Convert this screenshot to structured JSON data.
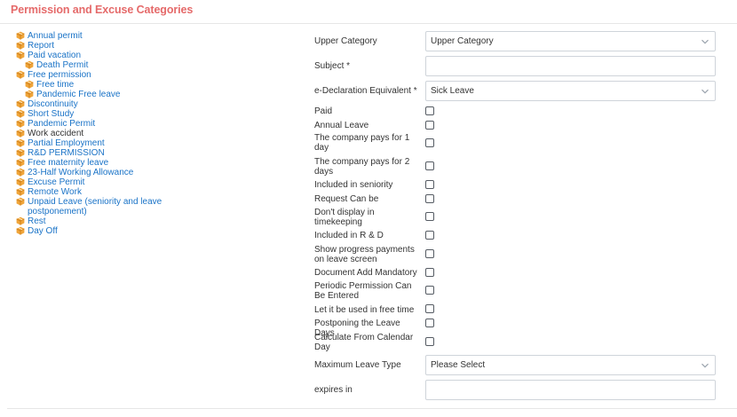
{
  "header": {
    "title": "Permission and Excuse Categories"
  },
  "tree": {
    "items": [
      {
        "label": "Annual permit",
        "child": false,
        "black": false
      },
      {
        "label": "Report",
        "child": false,
        "black": false
      },
      {
        "label": "Paid vacation",
        "child": false,
        "black": false
      },
      {
        "label": "Death Permit",
        "child": true,
        "black": false
      },
      {
        "label": "Free permission",
        "child": false,
        "black": false
      },
      {
        "label": "Free time",
        "child": true,
        "black": false
      },
      {
        "label": "Pandemic Free leave",
        "child": true,
        "black": false
      },
      {
        "label": "Discontinuity",
        "child": false,
        "black": false
      },
      {
        "label": "Short Study",
        "child": false,
        "black": false
      },
      {
        "label": "Pandemic Permit",
        "child": false,
        "black": false
      },
      {
        "label": "Work accident",
        "child": false,
        "black": true
      },
      {
        "label": "Partial Employment",
        "child": false,
        "black": false
      },
      {
        "label": "R&D PERMISSION",
        "child": false,
        "black": false
      },
      {
        "label": "Free maternity leave",
        "child": false,
        "black": false
      },
      {
        "label": "23-Half Working Allowance",
        "child": false,
        "black": false
      },
      {
        "label": "Excuse Permit",
        "child": false,
        "black": false
      },
      {
        "label": "Remote Work",
        "child": false,
        "black": false
      },
      {
        "label": "Unpaid Leave (seniority and leave postponement)",
        "child": false,
        "black": false
      },
      {
        "label": "Rest",
        "child": false,
        "black": false
      },
      {
        "label": "Day Off",
        "child": false,
        "black": false
      }
    ]
  },
  "form": {
    "upper_category": {
      "label": "Upper Category",
      "value": "Upper Category"
    },
    "subject": {
      "label": "Subject *",
      "value": ""
    },
    "edeclaration": {
      "label": "e-Declaration Equivalent *",
      "value": "Sick Leave"
    },
    "checkboxes": [
      {
        "label": "Paid",
        "checked": false
      },
      {
        "label": "Annual Leave",
        "checked": false
      },
      {
        "label": "The company pays for 1 day",
        "checked": false
      },
      {
        "label": "The company pays for 2 days",
        "checked": false
      },
      {
        "label": "Included in seniority",
        "checked": false
      },
      {
        "label": "Request Can be",
        "checked": false
      },
      {
        "label": "Don't display in timekeeping",
        "checked": false
      },
      {
        "label": "Included in R & D",
        "checked": false
      },
      {
        "label": "Show progress payments on leave screen",
        "checked": false
      },
      {
        "label": "Document Add Mandatory",
        "checked": false
      },
      {
        "label": "Periodic Permission Can Be Entered",
        "checked": false
      },
      {
        "label": "Let it be used in free time",
        "checked": false
      },
      {
        "label": "Postponing the Leave Days",
        "checked": false
      },
      {
        "label": "Calculate From Calendar Day",
        "checked": false
      }
    ],
    "max_leave_type": {
      "label": "Maximum Leave Type",
      "value": "Please Select"
    },
    "expires_in": {
      "label": "expires in",
      "value": ""
    }
  },
  "colors": {
    "title": "#e56a6a",
    "link": "#1a73c7",
    "folder": "#f0a53a"
  },
  "icons": {
    "tree_item": "folder-box-icon",
    "select": "chevron-down-icon"
  }
}
